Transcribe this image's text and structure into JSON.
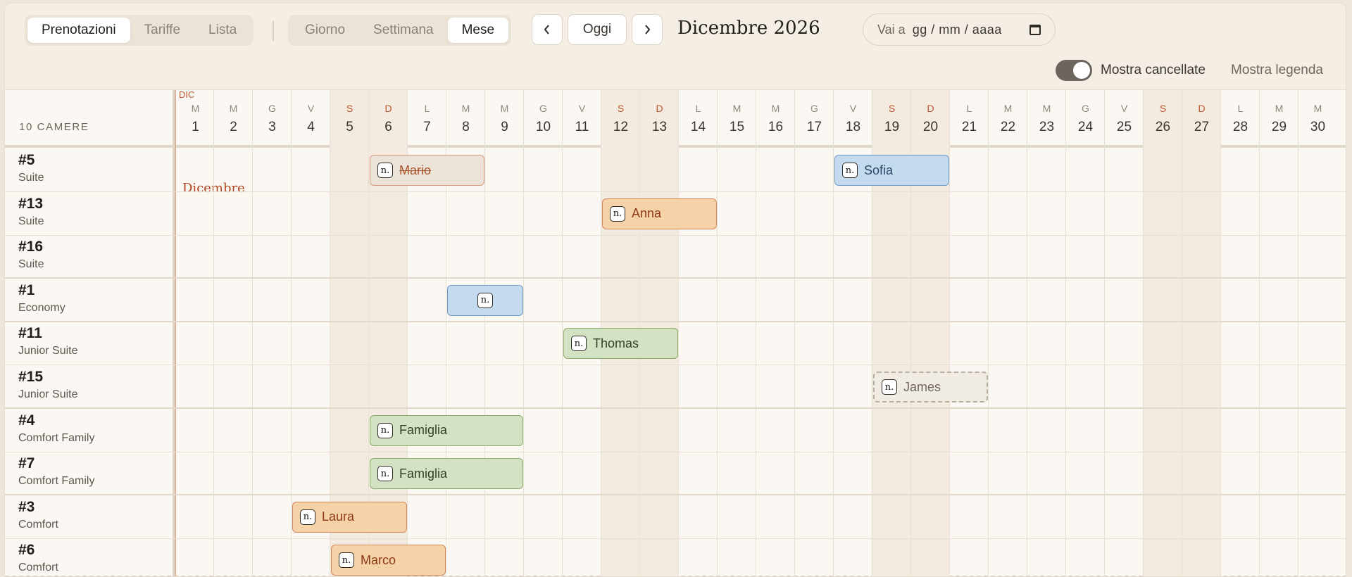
{
  "view_tabs": [
    {
      "label": "Prenotazioni",
      "active": true
    },
    {
      "label": "Tariffe",
      "active": false
    },
    {
      "label": "Lista",
      "active": false
    }
  ],
  "range_tabs": [
    {
      "label": "Giorno",
      "active": false
    },
    {
      "label": "Settimana",
      "active": false
    },
    {
      "label": "Mese",
      "active": true
    }
  ],
  "nav": {
    "prev_icon": "chevron-left-icon",
    "today_label": "Oggi",
    "next_icon": "chevron-right-icon"
  },
  "month_title": "Dicembre 2026",
  "goto": {
    "label": "Vai a",
    "date_placeholder": "gg / mm / aaaa",
    "icon": "calendar-icon"
  },
  "toggle": {
    "label": "Mostra cancellate",
    "on": true
  },
  "legend_link": "Mostra legenda",
  "grid_header": {
    "rooms_count": "10 CAMERE",
    "month_abbr": "DIC",
    "month_label": "Dicembre"
  },
  "days": [
    {
      "dow": "M",
      "num": "1"
    },
    {
      "dow": "M",
      "num": "2"
    },
    {
      "dow": "G",
      "num": "3"
    },
    {
      "dow": "V",
      "num": "4"
    },
    {
      "dow": "S",
      "num": "5"
    },
    {
      "dow": "D",
      "num": "6"
    },
    {
      "dow": "L",
      "num": "7"
    },
    {
      "dow": "M",
      "num": "8"
    },
    {
      "dow": "M",
      "num": "9"
    },
    {
      "dow": "G",
      "num": "10"
    },
    {
      "dow": "V",
      "num": "11"
    },
    {
      "dow": "S",
      "num": "12"
    },
    {
      "dow": "D",
      "num": "13"
    },
    {
      "dow": "L",
      "num": "14"
    },
    {
      "dow": "M",
      "num": "15"
    },
    {
      "dow": "M",
      "num": "16"
    },
    {
      "dow": "G",
      "num": "17"
    },
    {
      "dow": "V",
      "num": "18"
    },
    {
      "dow": "S",
      "num": "19"
    },
    {
      "dow": "D",
      "num": "20"
    },
    {
      "dow": "L",
      "num": "21"
    },
    {
      "dow": "M",
      "num": "22"
    },
    {
      "dow": "M",
      "num": "23"
    },
    {
      "dow": "G",
      "num": "24"
    },
    {
      "dow": "V",
      "num": "25"
    },
    {
      "dow": "S",
      "num": "26"
    },
    {
      "dow": "D",
      "num": "27"
    },
    {
      "dow": "L",
      "num": "28"
    },
    {
      "dow": "M",
      "num": "29"
    },
    {
      "dow": "M",
      "num": "30"
    }
  ],
  "rooms": [
    {
      "number": "#5",
      "type": "Suite"
    },
    {
      "number": "#13",
      "type": "Suite"
    },
    {
      "number": "#16",
      "type": "Suite"
    },
    {
      "number": "#1",
      "type": "Economy"
    },
    {
      "number": "#11",
      "type": "Junior Suite"
    },
    {
      "number": "#15",
      "type": "Junior Suite"
    },
    {
      "number": "#4",
      "type": "Comfort Family"
    },
    {
      "number": "#7",
      "type": "Comfort Family"
    },
    {
      "number": "#3",
      "type": "Comfort"
    },
    {
      "number": "#6",
      "type": "Comfort"
    }
  ],
  "bookings": [
    {
      "room": "#5",
      "guest": "Mario",
      "start": 6,
      "end": 8,
      "status": "cancelled",
      "badge": "n."
    },
    {
      "room": "#5",
      "guest": "Sofia",
      "start": 18,
      "end": 20,
      "status": "blue",
      "badge": "n."
    },
    {
      "room": "#13",
      "guest": "Anna",
      "start": 12,
      "end": 14,
      "status": "orange",
      "badge": "n."
    },
    {
      "room": "#1",
      "guest": "",
      "start": 8,
      "end": 9,
      "status": "blue",
      "badge": "n."
    },
    {
      "room": "#11",
      "guest": "Thomas",
      "start": 11,
      "end": 13,
      "status": "green",
      "badge": "n."
    },
    {
      "room": "#15",
      "guest": "James",
      "start": 19,
      "end": 21,
      "status": "pending",
      "badge": "n."
    },
    {
      "room": "#4",
      "guest": "Famiglia",
      "start": 6,
      "end": 9,
      "status": "green",
      "badge": "n."
    },
    {
      "room": "#7",
      "guest": "Famiglia",
      "start": 6,
      "end": 9,
      "status": "green",
      "badge": "n."
    },
    {
      "room": "#3",
      "guest": "Laura",
      "start": 4,
      "end": 6,
      "status": "orange",
      "badge": "n."
    },
    {
      "room": "#6",
      "guest": "Marco",
      "start": 5,
      "end": 7,
      "status": "orange",
      "badge": "n."
    }
  ],
  "colors": {
    "accent": "#c0562e",
    "weekend_bg": "#f3ebdf",
    "toggle_on": "#6b655d"
  }
}
